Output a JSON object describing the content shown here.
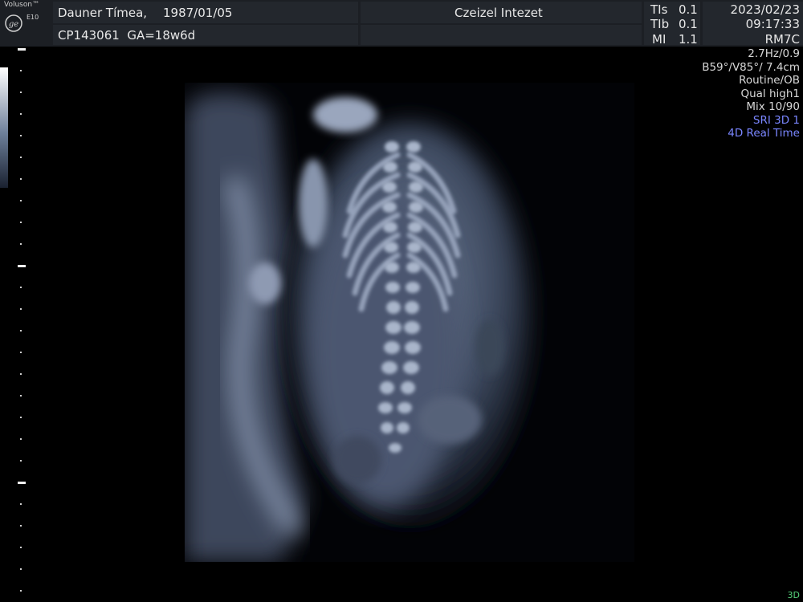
{
  "header": {
    "brand_name": "Voluson™",
    "brand_model": "E10",
    "logo_icon": "ge-logo-icon",
    "patient_name": "Dauner Tímea,",
    "patient_dob": "1987/01/05",
    "patient_id_ga": "CP143061  GA=18w6d",
    "institution": "Czeizel Intezet",
    "indices": [
      {
        "label": "TIs",
        "value": "0.1"
      },
      {
        "label": "TIb",
        "value": "0.1"
      },
      {
        "label": "MI",
        "value": "1.1"
      }
    ],
    "date": "2023/02/23",
    "time": "09:17:33",
    "probe": "RM7C"
  },
  "settings": {
    "rate": "2.7Hz/0.9",
    "angles_depth": "B59°/V85°/ 7.4cm",
    "preset": "Routine/OB",
    "quality": "Qual high1",
    "mix": "Mix 10/90",
    "sri": "SRI 3D 1",
    "mode": "4D Real Time",
    "accent_color": "#7a86ff"
  },
  "footer": {
    "corner_label": "3D"
  }
}
